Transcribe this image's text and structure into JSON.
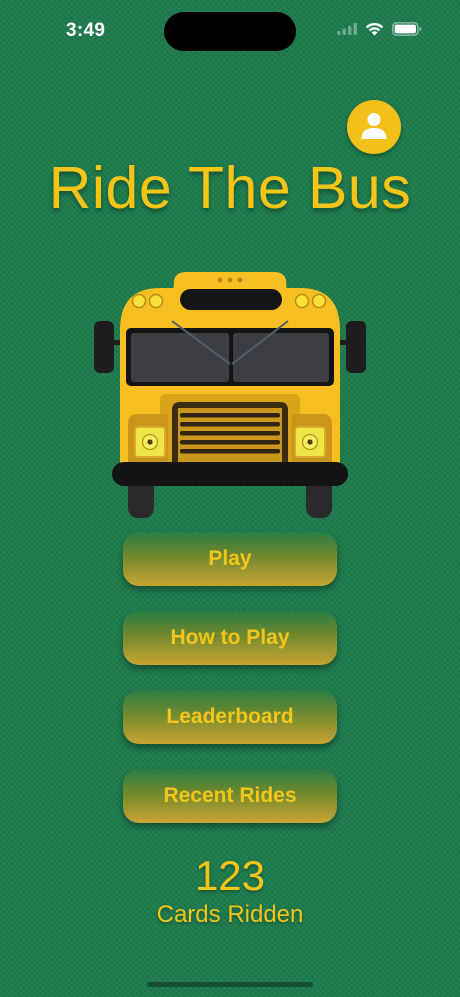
{
  "status_bar": {
    "time": "3:49"
  },
  "header": {
    "title": "Ride The Bus",
    "profile_icon": "person-icon"
  },
  "menu": {
    "buttons": [
      {
        "label": "Play"
      },
      {
        "label": "How to Play"
      },
      {
        "label": "Leaderboard"
      },
      {
        "label": "Recent Rides"
      }
    ]
  },
  "stats": {
    "cards_ridden_count": "123",
    "cards_ridden_label": "Cards Ridden"
  },
  "colors": {
    "background": "#1c7a4c",
    "accent_yellow": "#f4c417",
    "bus_yellow": "#f6be1e"
  }
}
